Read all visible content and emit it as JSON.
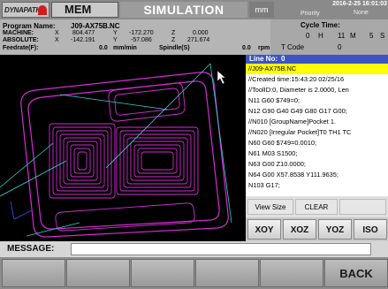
{
  "header": {
    "logo_text": "DYNAPATH",
    "mode": "MEM",
    "title": "SIMULATION",
    "unit": "mm",
    "datetime_date": "2016-2-25",
    "datetime_time": "16:01:03",
    "priority_label": "Priority",
    "priority_value": "None"
  },
  "program": {
    "name_label": "Program Name:",
    "name": "J09-AX75B.NC",
    "machine_label": "MACHINE:",
    "absolute_label": "ABSOLUTE:",
    "feedrate_label": "Feedrate(F):",
    "x_label": "X",
    "y_label": "Y",
    "z_label": "Z",
    "machine_x": "804.477",
    "machine_y": "-172.270",
    "machine_z": "0.000",
    "absolute_x": "-142.191",
    "absolute_y": "-57.086",
    "absolute_z": "271.674",
    "feedrate": "0.0",
    "feed_unit": "mm/min",
    "spindle_label": "Spindle(S)",
    "spindle": "0.0",
    "spindle_unit": "rpm"
  },
  "cycle": {
    "label": "Cycle Time:",
    "hours": "0",
    "h_label": "H",
    "minutes": "11",
    "m_label": "M",
    "seconds": "5",
    "s_label": "S",
    "tcode_label": "T Code",
    "tcode": "0"
  },
  "code_panel": {
    "line_no_label": "Line No:",
    "line_no": "0",
    "lines": [
      "//J09-AX75B.NC",
      "//Created time:15:43:20 02/25/16",
      "//ToolID:0, Diameter is 2.0000, Len",
      "N11 G60 $749=0;",
      "N12 G90 G40 G49 G80 G17 G00;",
      "//N010 [GroupName]Pocket 1.",
      "//N020 [Irregular Pocket]T0 TH1 TC",
      "N60 G60 $749=0.0010;",
      "N61 M03 S1500;",
      "N63 G00 Z10.0000;",
      "N64 G00 X57.8538 Y111.9635;",
      "N103 G17;"
    ]
  },
  "view_controls": {
    "view_size": "View Size",
    "clear": "CLEAR",
    "axes": [
      "XOY",
      "XOZ",
      "YOZ",
      "ISO"
    ]
  },
  "message": {
    "label": "MESSAGE:",
    "value": ""
  },
  "softkeys": [
    "",
    "",
    "",
    "",
    "",
    "BACK"
  ],
  "colors": {
    "toolpath": "#d42bd4",
    "rapid": "#2ad6d6",
    "highlight": "#ffff00",
    "line_no_bg": "#3c55c4"
  }
}
